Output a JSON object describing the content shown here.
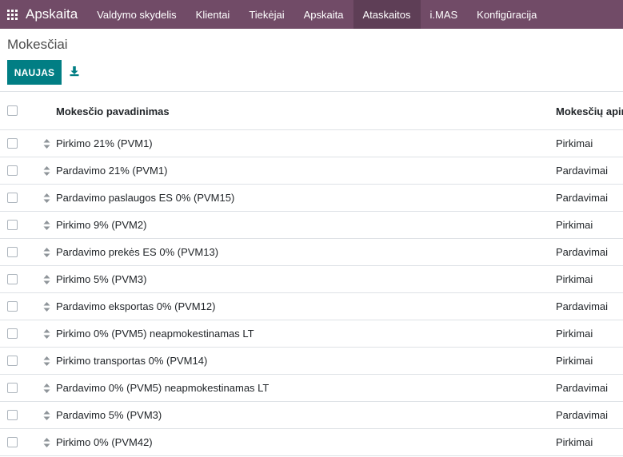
{
  "navbar": {
    "app_name": "Apskaita",
    "menu": [
      {
        "label": "Valdymo skydelis"
      },
      {
        "label": "Klientai"
      },
      {
        "label": "Tiekėjai"
      },
      {
        "label": "Apskaita"
      },
      {
        "label": "Ataskaitos"
      },
      {
        "label": "i.MAS"
      },
      {
        "label": "Konfigūracija"
      }
    ],
    "active_item": "Ataskaitos",
    "color": "#714b67"
  },
  "page": {
    "title": "Mokesčiai",
    "new_button": "NAUJAS",
    "download_icon": "download-icon",
    "accent_color": "#017e84"
  },
  "table": {
    "columns": {
      "name": "Mokesčio pavadinimas",
      "scope": "Mokesčių apim"
    },
    "rows": [
      {
        "name": "Pirkimo 21% (PVM1)",
        "scope": "Pirkimai"
      },
      {
        "name": "Pardavimo 21% (PVM1)",
        "scope": "Pardavimai"
      },
      {
        "name": "Pardavimo paslaugos ES 0% (PVM15)",
        "scope": "Pardavimai"
      },
      {
        "name": "Pirkimo 9% (PVM2)",
        "scope": "Pirkimai"
      },
      {
        "name": "Pardavimo prekės ES 0% (PVM13)",
        "scope": "Pardavimai"
      },
      {
        "name": "Pirkimo 5% (PVM3)",
        "scope": "Pirkimai"
      },
      {
        "name": "Pardavimo eksportas 0% (PVM12)",
        "scope": "Pardavimai"
      },
      {
        "name": "Pirkimo 0% (PVM5) neapmokestinamas LT",
        "scope": "Pirkimai"
      },
      {
        "name": "Pirkimo transportas 0% (PVM14)",
        "scope": "Pirkimai"
      },
      {
        "name": "Pardavimo 0% (PVM5) neapmokestinamas LT",
        "scope": "Pardavimai"
      },
      {
        "name": "Pardavimo 5% (PVM3)",
        "scope": "Pardavimai"
      },
      {
        "name": "Pirkimo 0% (PVM42)",
        "scope": "Pirkimai"
      }
    ]
  }
}
